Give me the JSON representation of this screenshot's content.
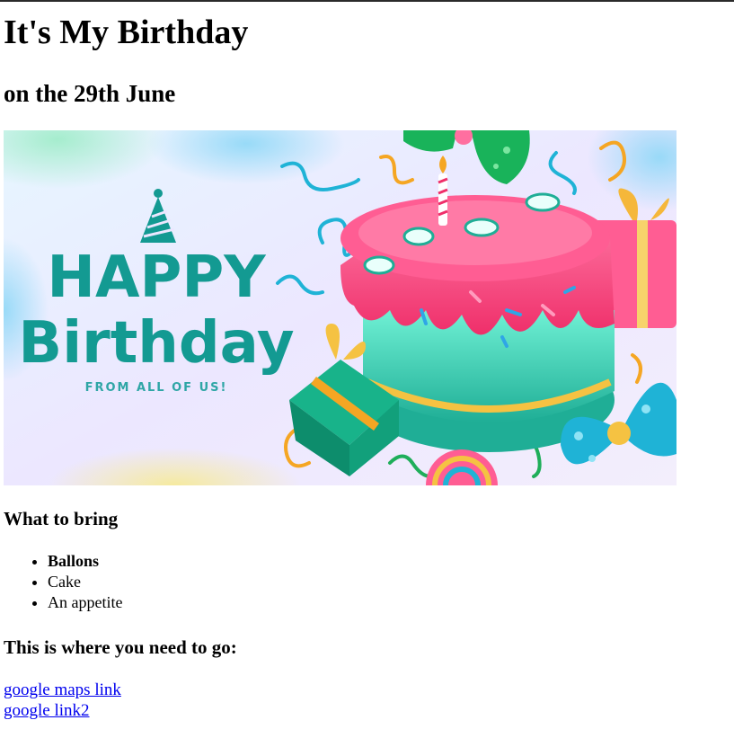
{
  "heading": "It's My Birthday",
  "subheading": "on the 29th June",
  "banner": {
    "line1": "HAPPY",
    "line2": "Birthday",
    "tagline": "FROM ALL OF US!"
  },
  "bring": {
    "title": "What to bring",
    "items": [
      "Ballons",
      "Cake",
      "An appetite"
    ]
  },
  "directions": {
    "title": "This is where you need to go:",
    "links": [
      "google maps link",
      "google link2"
    ]
  },
  "colors": {
    "link": "#0000ee",
    "banner_text": "#139a92",
    "frosting": "#f4477e",
    "cake_base": "#3fd3b6"
  }
}
